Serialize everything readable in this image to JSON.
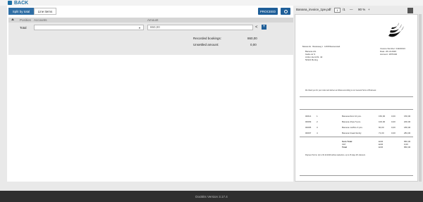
{
  "header": {
    "back_label": "BACK"
  },
  "tabs": {
    "split_label": "Split by total",
    "lines_label": "Line items"
  },
  "toolbar": {
    "proceed_label": "PROCEED"
  },
  "table": {
    "col_position": "Position",
    "col_accounts": "Accounts",
    "col_amount": "Amount",
    "row_label": "Total",
    "account_value": "",
    "amount_value": "860,00",
    "recorded_label": "Recorded bookings:",
    "recorded_value": "860,00",
    "unsettled_label": "Unsettled amount:",
    "unsettled_value": "0,00"
  },
  "viewer": {
    "filename": "Banana_invoice_1pe.pdf",
    "page_current": "1",
    "page_total": "/1",
    "zoom_minus": "—",
    "zoom": "90 %",
    "zoom_plus": "+"
  },
  "invoice": {
    "sender_line": "Banana AG · Bananaweg 1 · 12345 Bananenstadt",
    "recipient": [
      "Banana AG",
      "Gabo.str 9",
      "Anfen-Gerd-St. 42",
      "54321 Boring"
    ],
    "meta": [
      "Invoice Number: 01100013",
      "Date: 26.10.2020",
      "Account: 1870440"
    ],
    "intro": "We thank you for your order and deliver as follows according to our General Terms of Business:",
    "rows": [
      [
        "00014",
        "1",
        "Bananenbrot 10 pcs.",
        "150,00",
        "0,00",
        "150,00"
      ],
      [
        "00009",
        "2",
        "Banana chips 5 pcs.",
        "100,00",
        "0,00",
        "200,00"
      ],
      [
        "00005",
        "3",
        "Banana muffins 3 pcs.",
        "60,00",
        "0,00",
        "180,00"
      ],
      [
        "00007",
        "4",
        "Banana bread family",
        "71,00",
        "0,00",
        "284,00"
      ]
    ],
    "totals": [
      [
        "Sum Total",
        "EUR",
        "860,00"
      ],
      [
        "VAT",
        "EUR",
        "0,00"
      ],
      [
        "Total",
        "EUR",
        "860,00"
      ]
    ],
    "payment_note": "Payment Terms: Up to 30.10.2020 without deduction, up to 15 days 2% discount."
  },
  "footer": {
    "version": "DocBits Version 3.17.4"
  }
}
